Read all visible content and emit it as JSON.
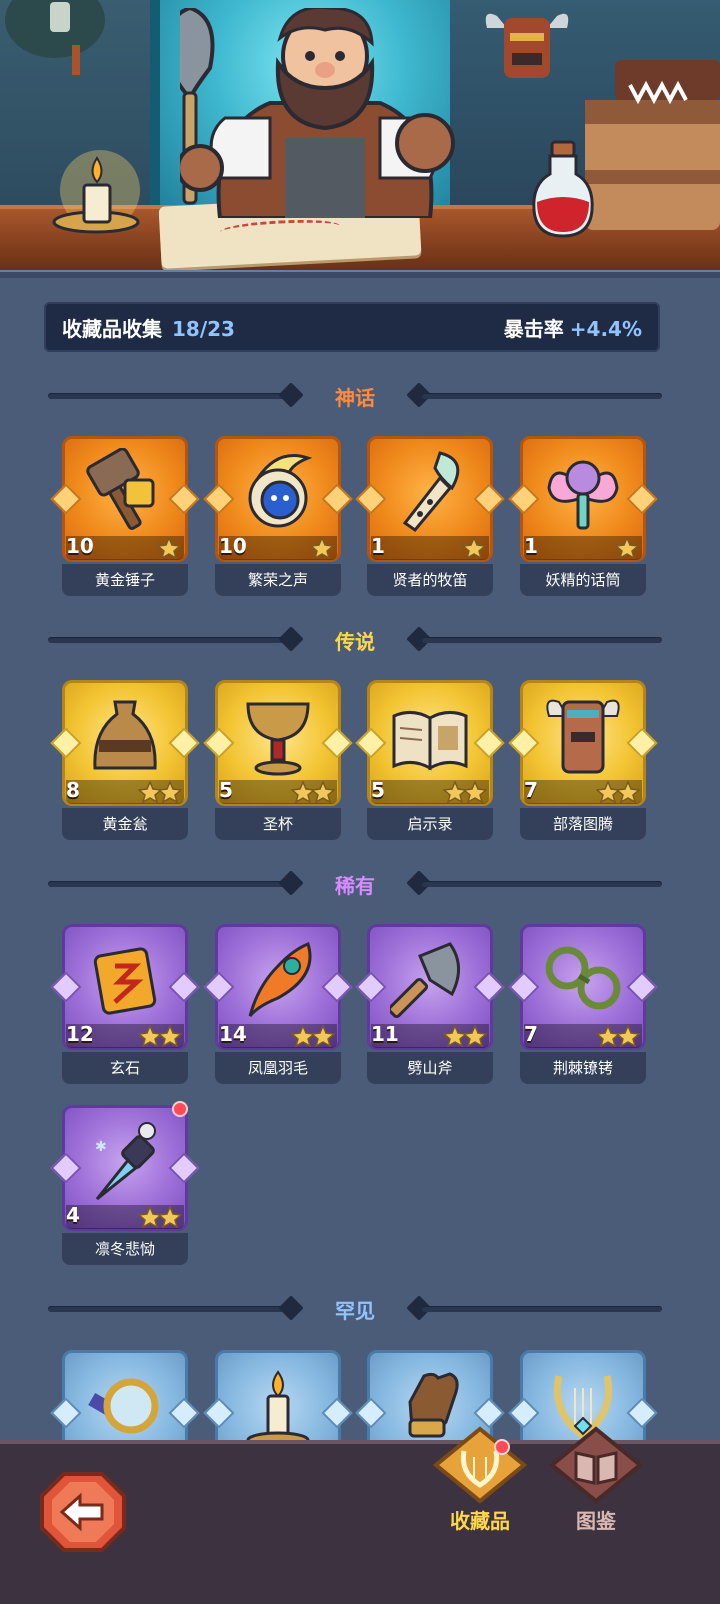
{
  "collection": {
    "label": "收藏品收集",
    "count": "18/23",
    "stat_label": "暴击率",
    "stat_value": "+4.4%"
  },
  "sections": {
    "myth": {
      "title": "神话",
      "color": "#ff8a3d",
      "items": [
        {
          "name": "黄金锤子",
          "level": "10",
          "stars": 1,
          "icon": "golden-hammer-icon"
        },
        {
          "name": "繁荣之声",
          "level": "10",
          "stars": 1,
          "icon": "prosperity-voice-icon"
        },
        {
          "name": "贤者的牧笛",
          "level": "1",
          "stars": 1,
          "icon": "sage-pipe-icon"
        },
        {
          "name": "妖精的话筒",
          "level": "1",
          "stars": 1,
          "icon": "fairy-microphone-icon"
        }
      ]
    },
    "legend": {
      "title": "传说",
      "color": "#ffd84a",
      "items": [
        {
          "name": "黄金瓮",
          "level": "8",
          "stars": 2,
          "icon": "golden-urn-icon"
        },
        {
          "name": "圣杯",
          "level": "5",
          "stars": 2,
          "icon": "holy-grail-icon"
        },
        {
          "name": "启示录",
          "level": "5",
          "stars": 2,
          "icon": "revelation-book-icon"
        },
        {
          "name": "部落图腾",
          "level": "7",
          "stars": 2,
          "icon": "tribal-totem-icon"
        }
      ]
    },
    "rare": {
      "title": "稀有",
      "color": "#d68cff",
      "items": [
        {
          "name": "玄石",
          "level": "12",
          "stars": 2,
          "icon": "mystic-stone-icon"
        },
        {
          "name": "凤凰羽毛",
          "level": "14",
          "stars": 2,
          "icon": "phoenix-feather-icon"
        },
        {
          "name": "劈山斧",
          "level": "11",
          "stars": 2,
          "icon": "mountain-axe-icon"
        },
        {
          "name": "荆棘镣铐",
          "level": "7",
          "stars": 2,
          "icon": "thorn-shackles-icon"
        },
        {
          "name": "凛冬悲恸",
          "level": "4",
          "stars": 2,
          "icon": "winter-dagger-icon",
          "notification": true
        }
      ]
    },
    "uncommon": {
      "title": "罕见",
      "color": "#8fc4ff",
      "items": [
        {
          "icon": "magnifier-icon"
        },
        {
          "icon": "candle-icon"
        },
        {
          "icon": "leather-glove-icon"
        },
        {
          "icon": "lyre-icon"
        }
      ]
    }
  },
  "nav": {
    "collectibles_label": "收藏品",
    "collectibles_active": true,
    "collectibles_notification": true,
    "codex_label": "图鉴",
    "back_icon": "back-arrow-icon"
  }
}
